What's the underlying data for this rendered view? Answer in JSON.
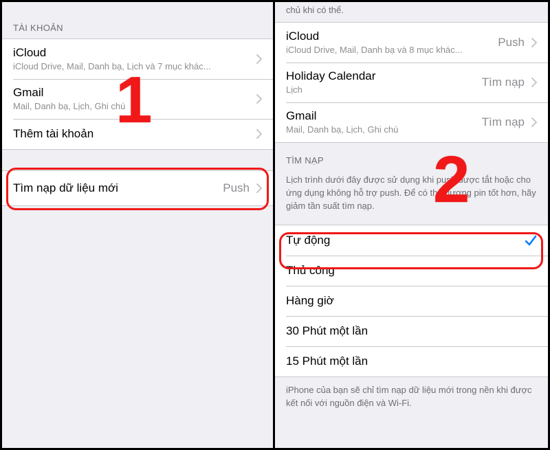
{
  "annotations": {
    "step1": "1",
    "step2": "2"
  },
  "left": {
    "section_accounts": "Tài khoản",
    "accounts": [
      {
        "title": "iCloud",
        "sub": "iCloud Drive, Mail, Danh bạ, Lịch và 7 mục khác..."
      },
      {
        "title": "Gmail",
        "sub": "Mail, Danh bạ, Lịch, Ghi chú"
      }
    ],
    "add_account": "Thêm tài khoản",
    "fetch_row": {
      "title": "Tìm nạp dữ liệu mới",
      "detail": "Push"
    }
  },
  "right": {
    "truncated_top": "chủ khi có thể.",
    "accounts": [
      {
        "title": "iCloud",
        "sub": "iCloud Drive, Mail, Danh bạ và 8 mục khác...",
        "detail": "Push"
      },
      {
        "title": "Holiday Calendar",
        "sub": "Lịch",
        "detail": "Tìm nạp"
      },
      {
        "title": "Gmail",
        "sub": "Mail, Danh bạ, Lịch, Ghi chú",
        "detail": "Tìm nạp"
      }
    ],
    "section_fetch": "Tìm nạp",
    "fetch_explainer": "Lịch trình dưới đây được sử dụng khi push được tắt hoặc cho ứng dụng không hỗ trợ push. Để có thời lượng pin tốt hơn, hãy giảm tần suất tìm nạp.",
    "options": [
      {
        "label": "Tự động",
        "selected": true
      },
      {
        "label": "Thủ công",
        "selected": false
      },
      {
        "label": "Hàng giờ",
        "selected": false
      },
      {
        "label": "30 Phút một lần",
        "selected": false
      },
      {
        "label": "15 Phút một lần",
        "selected": false
      }
    ],
    "bottom_note": "iPhone của bạn sẽ chỉ tìm nạp dữ liệu mới trong nền khi được kết nối với nguồn điện và Wi-Fi."
  }
}
